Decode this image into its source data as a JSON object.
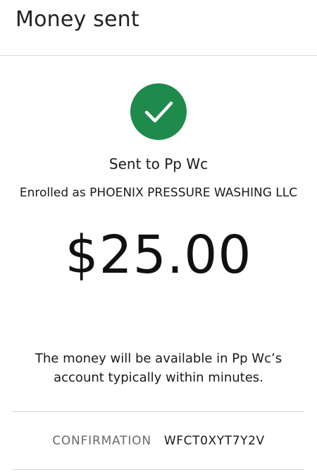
{
  "header": {
    "title": "Money sent"
  },
  "status": {
    "icon": "check-circle-icon",
    "color": "#1e8a4c"
  },
  "recipient": {
    "sent_to": "Sent to Pp Wc",
    "enrolled_as": "Enrolled as PHOENIX PRESSURE WASHING LLC"
  },
  "payment": {
    "amount": "$25.00"
  },
  "note": {
    "text": "The money will be available in Pp Wc’s account typically within minutes."
  },
  "confirmation": {
    "label": "CONFIRMATION",
    "code": "WFCT0XYT7Y2V"
  }
}
